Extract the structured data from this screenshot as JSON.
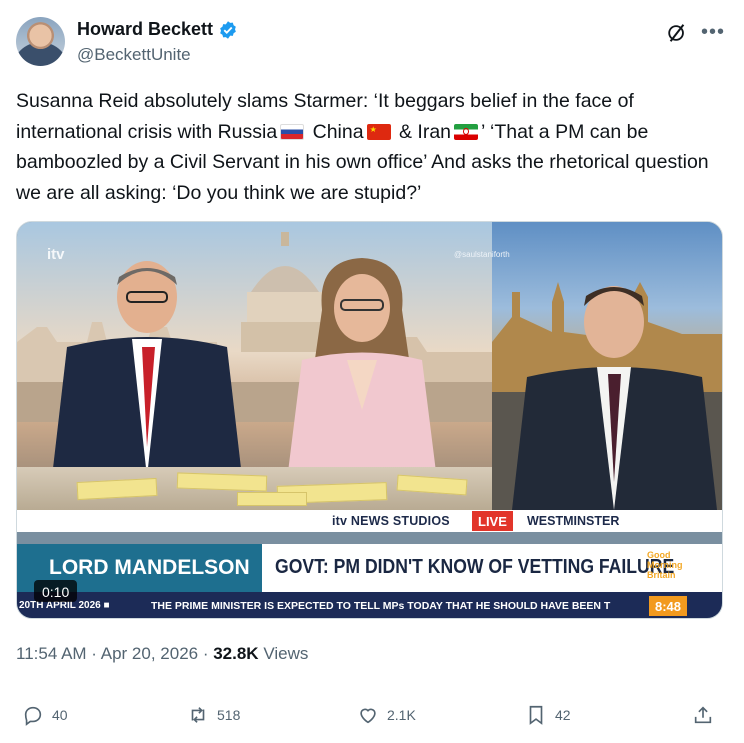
{
  "author": {
    "display_name": "Howard Beckett",
    "handle": "@BeckettUnite",
    "verified_icon": "verified-badge-icon",
    "avatar": "avatar"
  },
  "header_icons": [
    "grok-icon",
    "more-icon"
  ],
  "tweet": {
    "text_part1": "Susanna Reid absolutely slams Starmer: ‘It beggars belief in the face of international crisis with Russia",
    "text_part2": " China",
    "text_part3": " & Iran",
    "text_part4": "’ ‘That a PM can be bamboozled by a Civil Servant in his own office’ And asks the rhetorical question we are all asking: ‘Do you think we are stupid?’",
    "flags": [
      "russia-flag-icon",
      "china-flag-icon",
      "iran-flag-icon"
    ]
  },
  "media": {
    "watermark": "@saulstaniforth",
    "studio_logo": "itv",
    "location_left": "itv NEWS STUDIOS",
    "live_badge": "LIVE",
    "location_right": "WESTMINSTER",
    "strap_name": "LORD MANDELSON",
    "strap_headline": "GOVT: PM DIDN'T KNOW OF VETTING FAILURE",
    "show_logo_lines": [
      "Good",
      "Morning",
      "Britain"
    ],
    "ticker_date": "20TH APRIL 2026 ■",
    "ticker_text": "THE PRIME MINISTER IS EXPECTED TO TELL MPs TODAY THAT HE SHOULD HAVE BEEN T",
    "ticker_time": "8:48",
    "duration": "0:10"
  },
  "meta": {
    "time": "11:54 AM",
    "separator": " · ",
    "date": "Apr 20, 2026",
    "views_count": "32.8K",
    "views_label": " Views"
  },
  "actions": {
    "replies": "40",
    "reposts": "518",
    "likes": "2.1K",
    "bookmarks": "42"
  },
  "colors": {
    "text": "#0f1419",
    "secondary": "#536471",
    "verified": "#1d9bf0",
    "strap_name_bg": "#1e6f8f",
    "ticker_bg": "#1c2b57",
    "live_red": "#e2352a"
  }
}
